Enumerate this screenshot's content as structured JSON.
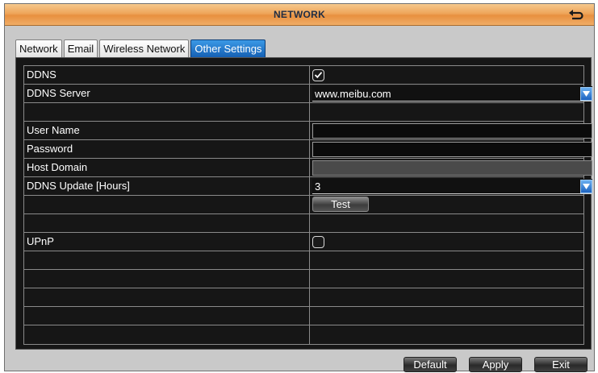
{
  "window": {
    "title": "NETWORK"
  },
  "tabs": [
    {
      "label": "Network",
      "active": false
    },
    {
      "label": "Email",
      "active": false
    },
    {
      "label": "Wireless Network",
      "active": false
    },
    {
      "label": "Other Settings",
      "active": true
    }
  ],
  "settings": {
    "ddns": {
      "label": "DDNS",
      "checked": true
    },
    "ddns_server": {
      "label": "DDNS Server",
      "value": "www.meibu.com"
    },
    "user_name": {
      "label": "User Name",
      "value": ""
    },
    "password": {
      "label": "Password",
      "value": ""
    },
    "host_domain": {
      "label": "Host Domain",
      "value": ""
    },
    "ddns_update": {
      "label": "DDNS Update [Hours]",
      "value": "3"
    },
    "test_button": {
      "label": "Test"
    },
    "upnp": {
      "label": "UPnP",
      "checked": false
    }
  },
  "footer": {
    "default_label": "Default",
    "apply_label": "Apply",
    "exit_label": "Exit"
  },
  "icons": {
    "back": "back-arrow-icon",
    "dropdown": "dropdown-arrow-icon",
    "check": "checkmark-icon"
  },
  "colors": {
    "accent_tab": "#1f74cf",
    "titlebar": "#eea55a",
    "panel": "#161616"
  }
}
